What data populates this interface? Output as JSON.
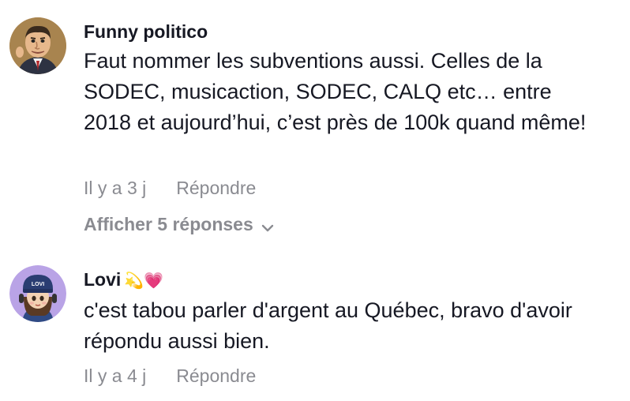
{
  "comments": [
    {
      "author": "Funny politico",
      "avatar_icon": "politician-caricature-avatar",
      "text": "Faut nommer les subventions aussi. Celles de la SODEC, musicaction, SODEC, CALQ etc… entre 2018 et aujourd’hui, c’est près de 100k quand même!",
      "time": "Il y a 3 j",
      "reply_label": "Répondre",
      "view_replies": "Afficher 5 réponses"
    },
    {
      "author": "Lovi",
      "author_emoji": "💫💗",
      "avatar_text": "LOVI",
      "avatar_icon": "girl-with-headphones-avatar",
      "text": "c'est tabou parler d'argent au Québec, bravo d'avoir répondu aussi bien.",
      "time": "Il y a 4 j",
      "reply_label": "Répondre"
    }
  ],
  "colors": {
    "primary_text": "#161823",
    "secondary_text": "#8a8b91",
    "background": "#ffffff"
  }
}
